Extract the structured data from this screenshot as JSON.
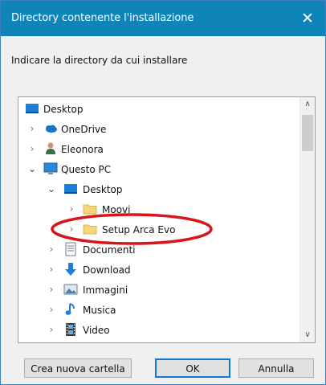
{
  "window": {
    "title": "Directory contenente l'installazione",
    "close_glyph": "✕"
  },
  "prompt": "Indicare la directory da cui installare",
  "tree": {
    "items": [
      {
        "label": "Desktop",
        "icon": "desktop-icon",
        "expander": ""
      },
      {
        "label": "OneDrive",
        "icon": "cloud-icon",
        "expander": "collapsed"
      },
      {
        "label": "Eleonora",
        "icon": "user-icon",
        "expander": "collapsed"
      },
      {
        "label": "Questo PC",
        "icon": "computer-icon",
        "expander": "expanded"
      },
      {
        "label": "Desktop",
        "icon": "desktop-icon",
        "expander": "expanded"
      },
      {
        "label": "Moovi",
        "icon": "folder-icon",
        "expander": "collapsed"
      },
      {
        "label": "Setup Arca Evo",
        "icon": "folder-icon",
        "expander": "collapsed"
      },
      {
        "label": "Documenti",
        "icon": "documents-icon",
        "expander": "collapsed"
      },
      {
        "label": "Download",
        "icon": "download-icon",
        "expander": "collapsed"
      },
      {
        "label": "Immagini",
        "icon": "pictures-icon",
        "expander": "collapsed"
      },
      {
        "label": "Musica",
        "icon": "music-icon",
        "expander": "collapsed"
      },
      {
        "label": "Video",
        "icon": "video-icon",
        "expander": "collapsed"
      }
    ]
  },
  "buttons": {
    "new_folder": "Crea nuova cartella",
    "ok": "OK",
    "cancel": "Annulla"
  },
  "colors": {
    "titlebar": "#0f84b8",
    "annotation": "#d9151b",
    "folder": "#f5d77a"
  }
}
